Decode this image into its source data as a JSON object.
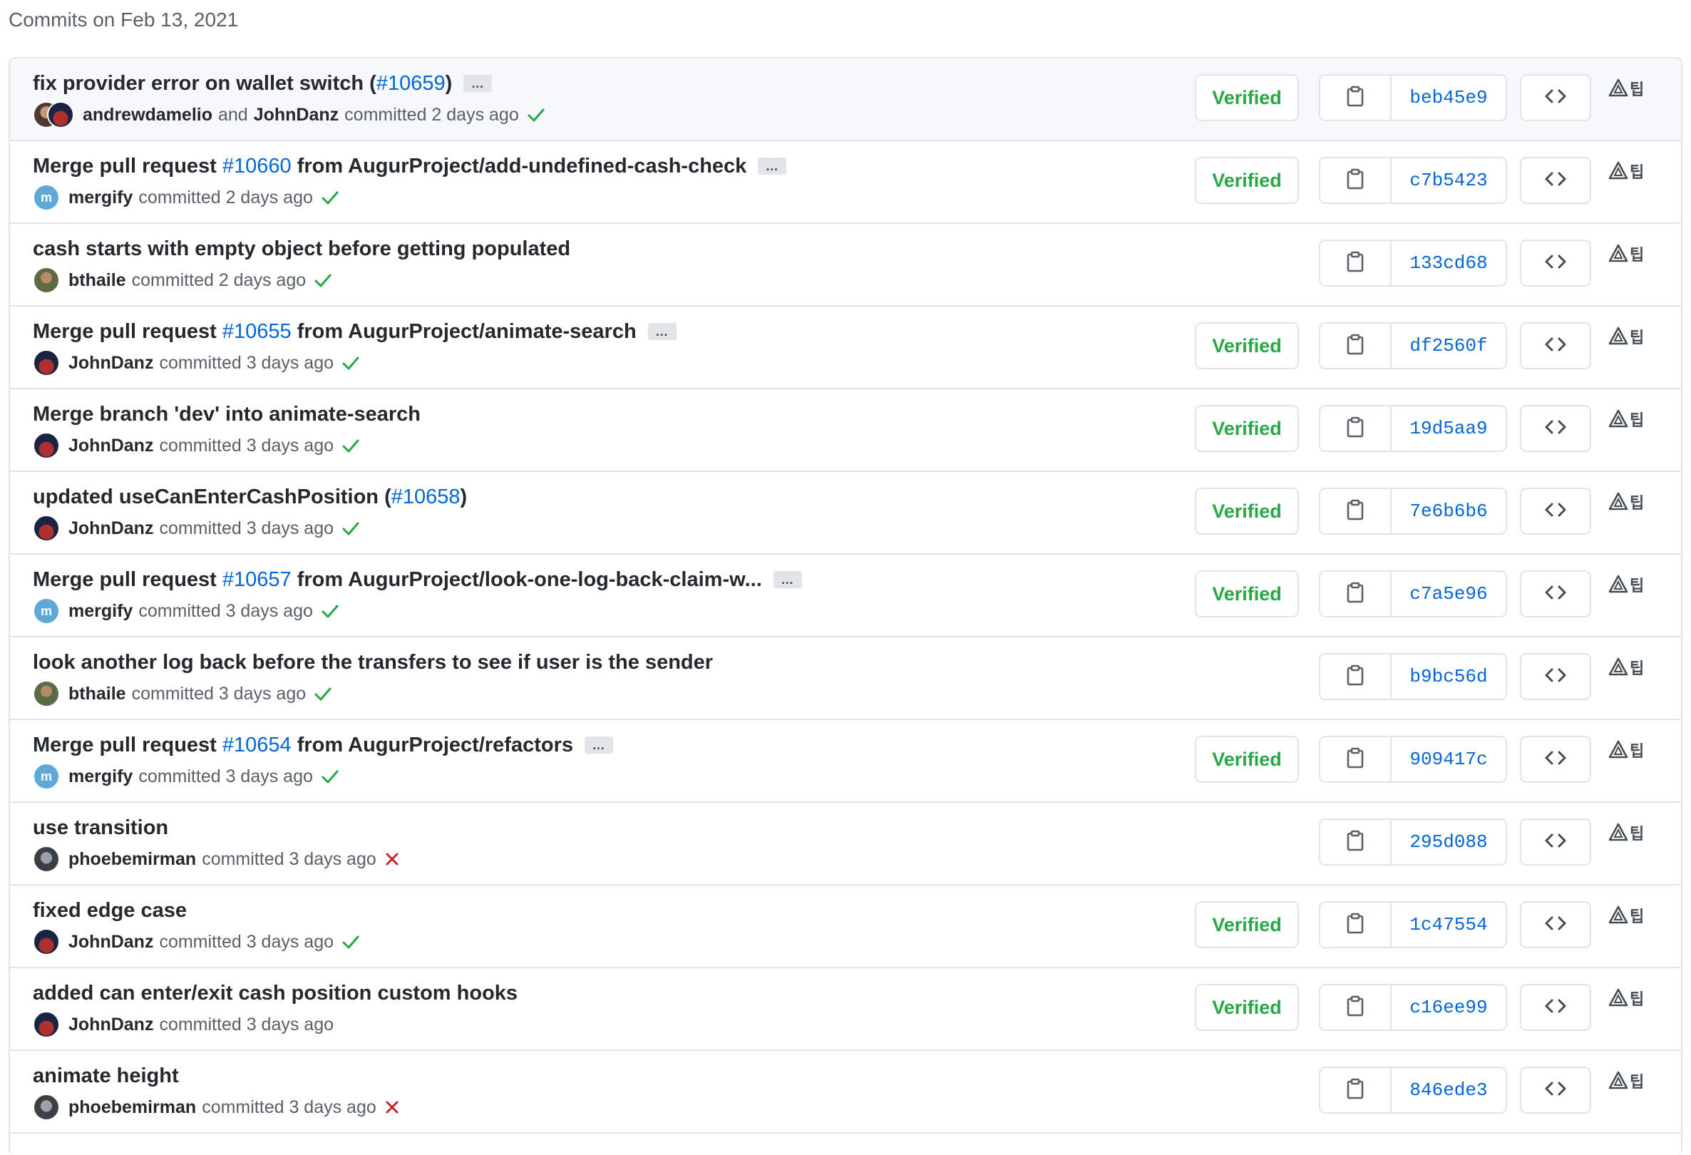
{
  "heading": "Commits on Feb 13, 2021",
  "labels": {
    "verified": "Verified",
    "and": "and",
    "ellipsis": "…",
    "ext_glyph": "팁"
  },
  "colors": {
    "link": "#0366d6",
    "success": "#28a745",
    "failure": "#cb2431",
    "muted": "#586069",
    "border": "#e1e4e8"
  },
  "commits": [
    {
      "title_before": "fix provider error on wallet switch (",
      "pr": "#10659",
      "title_after": ")",
      "has_ellipsis": true,
      "author": "andrewdamelio",
      "coauthor": "JohnDanz",
      "avatar": "andrew",
      "meta": "committed 2 days ago",
      "status": "success",
      "verified": true,
      "sha": "beb45e9"
    },
    {
      "title_before": "Merge pull request ",
      "pr": "#10660",
      "title_after": " from AugurProject/add-undefined-cash-check",
      "has_ellipsis": true,
      "author": "mergify",
      "coauthor": "",
      "avatar": "mergify",
      "meta": "committed 2 days ago",
      "status": "success",
      "verified": true,
      "sha": "c7b5423"
    },
    {
      "title_before": "cash starts with empty object before getting populated",
      "pr": "",
      "title_after": "",
      "has_ellipsis": false,
      "author": "bthaile",
      "coauthor": "",
      "avatar": "bthaile",
      "meta": "committed 2 days ago",
      "status": "success",
      "verified": false,
      "sha": "133cd68"
    },
    {
      "title_before": "Merge pull request ",
      "pr": "#10655",
      "title_after": " from AugurProject/animate-search",
      "has_ellipsis": true,
      "author": "JohnDanz",
      "coauthor": "",
      "avatar": "john",
      "meta": "committed 3 days ago",
      "status": "success",
      "verified": true,
      "sha": "df2560f"
    },
    {
      "title_before": "Merge branch 'dev' into animate-search",
      "pr": "",
      "title_after": "",
      "has_ellipsis": false,
      "author": "JohnDanz",
      "coauthor": "",
      "avatar": "john",
      "meta": "committed 3 days ago",
      "status": "success",
      "verified": true,
      "sha": "19d5aa9"
    },
    {
      "title_before": "updated useCanEnterCashPosition (",
      "pr": "#10658",
      "title_after": ")",
      "has_ellipsis": false,
      "author": "JohnDanz",
      "coauthor": "",
      "avatar": "john",
      "meta": "committed 3 days ago",
      "status": "success",
      "verified": true,
      "sha": "7e6b6b6"
    },
    {
      "title_before": "Merge pull request ",
      "pr": "#10657",
      "title_after": " from AugurProject/look-one-log-back-claim-w...",
      "has_ellipsis": true,
      "author": "mergify",
      "coauthor": "",
      "avatar": "mergify",
      "meta": "committed 3 days ago",
      "status": "success",
      "verified": true,
      "sha": "c7a5e96"
    },
    {
      "title_before": "look another log back before the transfers to see if user is the sender",
      "pr": "",
      "title_after": "",
      "has_ellipsis": false,
      "author": "bthaile",
      "coauthor": "",
      "avatar": "bthaile",
      "meta": "committed 3 days ago",
      "status": "success",
      "verified": false,
      "sha": "b9bc56d"
    },
    {
      "title_before": "Merge pull request ",
      "pr": "#10654",
      "title_after": " from AugurProject/refactors",
      "has_ellipsis": true,
      "author": "mergify",
      "coauthor": "",
      "avatar": "mergify",
      "meta": "committed 3 days ago",
      "status": "success",
      "verified": true,
      "sha": "909417c"
    },
    {
      "title_before": "use transition",
      "pr": "",
      "title_after": "",
      "has_ellipsis": false,
      "author": "phoebemirman",
      "coauthor": "",
      "avatar": "phoebe",
      "meta": "committed 3 days ago",
      "status": "failure",
      "verified": false,
      "sha": "295d088"
    },
    {
      "title_before": "fixed edge case",
      "pr": "",
      "title_after": "",
      "has_ellipsis": false,
      "author": "JohnDanz",
      "coauthor": "",
      "avatar": "john",
      "meta": "committed 3 days ago",
      "status": "success",
      "verified": true,
      "sha": "1c47554"
    },
    {
      "title_before": "added can enter/exit cash position custom hooks",
      "pr": "",
      "title_after": "",
      "has_ellipsis": false,
      "author": "JohnDanz",
      "coauthor": "",
      "avatar": "john",
      "meta": "committed 3 days ago",
      "status": "none",
      "verified": true,
      "sha": "c16ee99"
    },
    {
      "title_before": "animate height",
      "pr": "",
      "title_after": "",
      "has_ellipsis": false,
      "author": "phoebemirman",
      "coauthor": "",
      "avatar": "phoebe",
      "meta": "committed 3 days ago",
      "status": "failure",
      "verified": false,
      "sha": "846ede3"
    }
  ]
}
